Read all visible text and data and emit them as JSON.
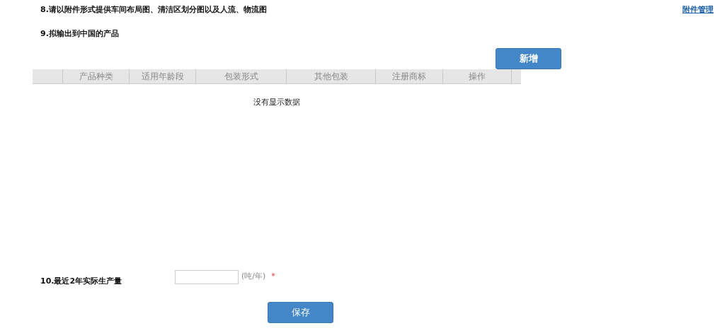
{
  "section_8": {
    "title": "8.请以附件形式提供车间布局图、清洁区划分图以及人流、物流图",
    "link": "附件管理"
  },
  "section_9": {
    "title": "9.拟输出到中国的产品",
    "add_button": "新增",
    "table": {
      "columns": [
        "产品种类",
        "适用年龄段",
        "包装形式",
        "其他包装",
        "注册商标",
        "操作"
      ],
      "empty_message": "没有显示数据"
    }
  },
  "section_10": {
    "label": "10.最近2年实际生产量",
    "unit": "(吨/年)",
    "required_mark": "*"
  },
  "save_button": "保存"
}
